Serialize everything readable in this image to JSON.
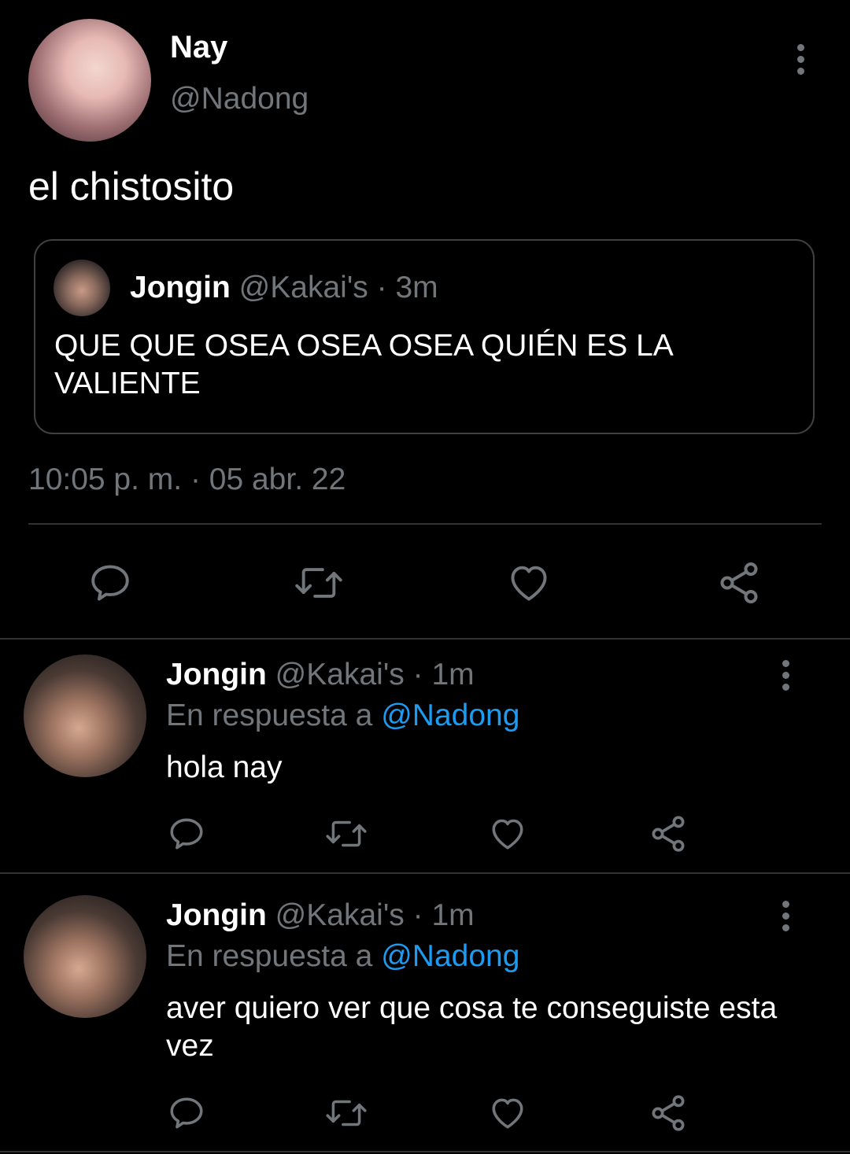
{
  "main_tweet": {
    "author_name": "Nay",
    "author_handle": "@Nadong",
    "text": "el chistosito",
    "quote": {
      "author_name": "Jongin",
      "author_handle": "@Kakai's",
      "separator": "·",
      "time": "3m",
      "text": "QUE QUE OSEA OSEA OSEA QUIÉN ES LA VALIENTE"
    },
    "timestamp": "10:05 p. m. · 05 abr. 22"
  },
  "replies": [
    {
      "author_name": "Jongin",
      "author_handle": "@Kakai's",
      "separator": "·",
      "time": "1m",
      "reply_prefix": "En respuesta a",
      "reply_mention": "@Nadong",
      "text": "hola nay"
    },
    {
      "author_name": "Jongin",
      "author_handle": "@Kakai's",
      "separator": "·",
      "time": "1m",
      "reply_prefix": "En respuesta a",
      "reply_mention": "@Nadong",
      "text": "aver quiero ver que cosa te conseguiste esta vez"
    }
  ],
  "icons": {
    "reply": "reply-icon",
    "retweet": "retweet-icon",
    "like": "heart-icon",
    "share": "share-icon",
    "more": "more-vertical-icon"
  },
  "colors": {
    "background": "#000000",
    "text": "#ffffff",
    "secondary": "#71767b",
    "link": "#1d9bf0",
    "border": "#2f3336"
  }
}
